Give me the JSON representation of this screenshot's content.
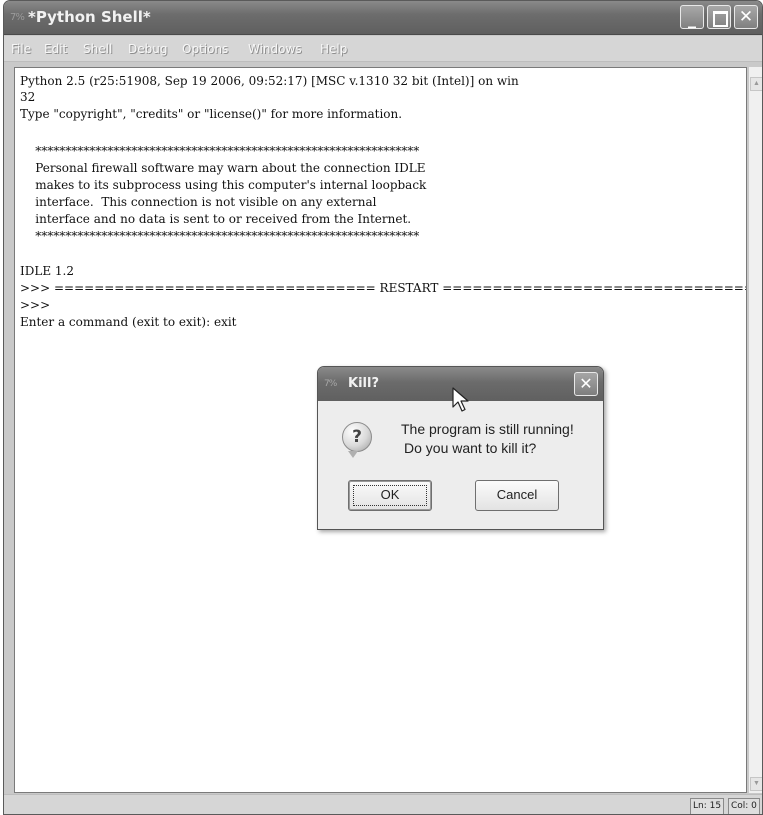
{
  "window": {
    "title": "*Python Shell*",
    "app_icon": "7%",
    "controls": {
      "minimize": "_",
      "close": "✕"
    }
  },
  "menu": [
    "File",
    "Edit",
    "Shell",
    "Debug",
    "Options",
    "Windows",
    "Help"
  ],
  "shell": {
    "lines": [
      "Python 2.5 (r25:51908, Sep 19 2006, 09:52:17) [MSC v.1310 32 bit (Intel)] on win",
      "32",
      "Type \"copyright\", \"credits\" or \"license()\" for more information.",
      "",
      "    ****************************************************************",
      "    Personal firewall software may warn about the connection IDLE",
      "    makes to its subprocess using this computer's internal loopback",
      "    interface.  This connection is not visible on any external",
      "    interface and no data is sent to or received from the Internet.",
      "    ****************************************************************",
      "",
      "IDLE 1.2",
      ">>> ================================ RESTART ================================",
      ">>>",
      "Enter a command (exit to exit): exit"
    ]
  },
  "status": {
    "line": "Ln: 15",
    "col": "Col: 0"
  },
  "dialog": {
    "title": "Kill?",
    "app_icon": "7%",
    "close": "✕",
    "icon": "question-icon",
    "icon_glyph": "?",
    "message_line1": "The program is still running!",
    "message_line2": "Do you want to kill it?",
    "ok_label": "OK",
    "cancel_label": "Cancel"
  },
  "colors": {
    "titlebar": "#6d6d6d",
    "dialog_bg": "#ededed"
  }
}
